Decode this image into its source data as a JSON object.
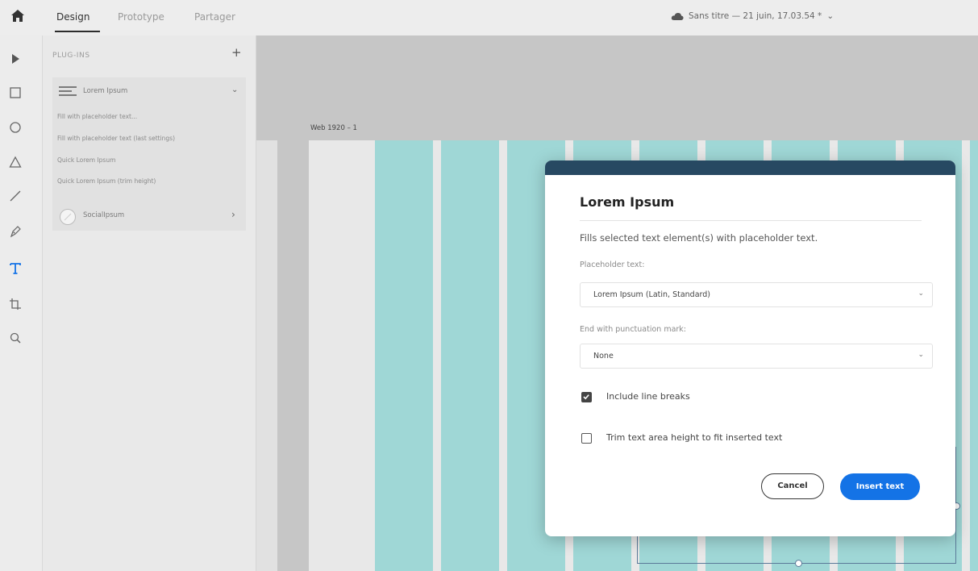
{
  "app": {
    "tabs": [
      {
        "label": "Design",
        "active": true
      },
      {
        "label": "Prototype",
        "active": false
      },
      {
        "label": "Partager",
        "active": false
      }
    ],
    "document_title": "Sans titre — 21 juin, 17.03.54 *"
  },
  "toolbar": {
    "tools": [
      "select-icon",
      "rectangle-icon",
      "ellipse-icon",
      "triangle-icon",
      "line-icon",
      "pen-icon",
      "text-icon",
      "artboard-icon",
      "zoom-icon"
    ],
    "active_tool": "text-icon"
  },
  "plugins_panel": {
    "header": "PLUG-INS",
    "plugins": [
      {
        "name": "Lorem Ipsum",
        "expanded": true,
        "commands": [
          "Fill with placeholder text...",
          "Fill with placeholder text (last settings)",
          "Quick Lorem Ipsum",
          "Quick Lorem Ipsum (trim height)"
        ]
      },
      {
        "name": "SocialIpsum",
        "expanded": false
      }
    ]
  },
  "canvas": {
    "artboard_label": "Web 1920 – 1"
  },
  "dialog": {
    "title": "Lorem Ipsum",
    "description": "Fills selected text element(s) with placeholder text.",
    "placeholder_label": "Placeholder text:",
    "placeholder_value": "Lorem Ipsum (Latin, Standard)",
    "punctuation_label": "End with punctuation mark:",
    "punctuation_value": "None",
    "include_line_breaks_label": "Include line breaks",
    "include_line_breaks_checked": true,
    "trim_height_label": "Trim text area height to fit inserted text",
    "trim_height_checked": false,
    "cancel_label": "Cancel",
    "insert_label": "Insert text"
  },
  "colors": {
    "accent": "#1473e6",
    "dialog_header": "#274962",
    "grid_columns": "#9fd7d6"
  }
}
